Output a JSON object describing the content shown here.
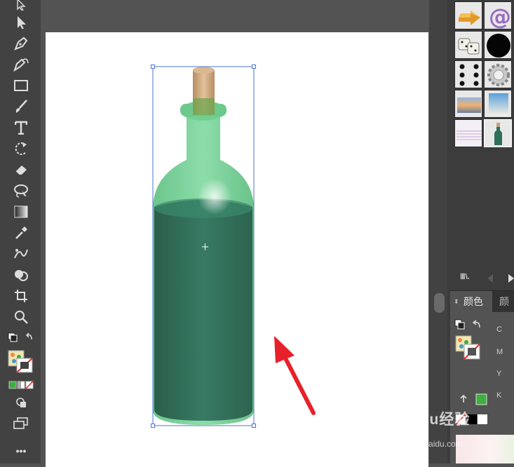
{
  "toolbar": {
    "tools": [
      "selection-tool",
      "direct-selection-tool",
      "pen-tool",
      "curvature-tool",
      "rectangle-tool",
      "paintbrush-tool",
      "type-tool",
      "rotate-tool",
      "eraser-tool",
      "lasso-tool",
      "gradient-tool",
      "eyedropper-tool",
      "blend-tool",
      "shape-builder-tool",
      "artboard-tool",
      "zoom-tool"
    ],
    "more_label": "•••"
  },
  "panel": {
    "color_tab_label": "颜色",
    "color_tab2_label": "颜色",
    "cmyk_labels": [
      "C",
      "M",
      "Y",
      "K"
    ],
    "library_icon": "library-icon",
    "fill_color": "#3fae3f"
  },
  "watermark": {
    "brand": "Baidu经验",
    "url": "jingyan.baidu.com"
  },
  "colors": {
    "bottle_dark": "#2e6f5a",
    "bottle_light": "#6ccc8f",
    "cork": "#c9a27a",
    "arrow": "#e8202a",
    "selection": "#4a74d6"
  }
}
